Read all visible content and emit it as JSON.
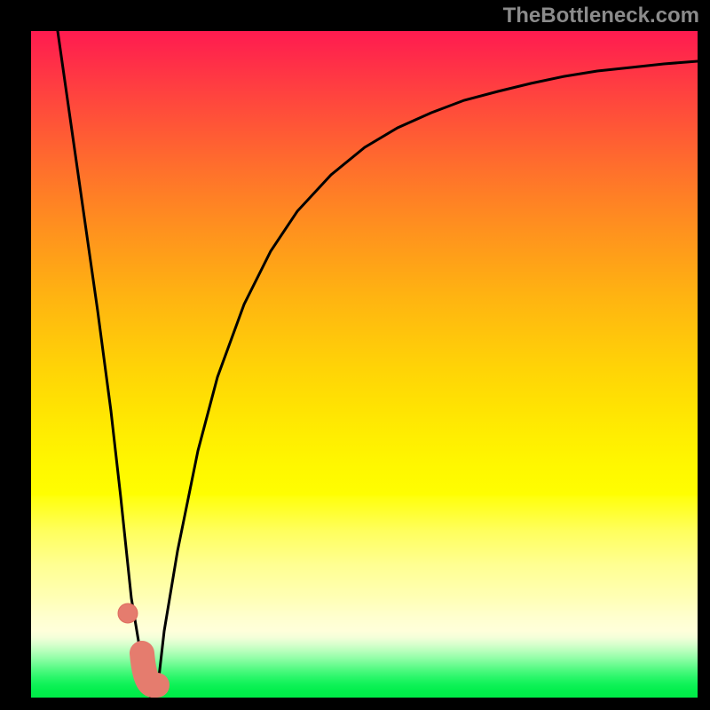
{
  "watermark": "TheBottleneck.com",
  "colors": {
    "page_bg": "#000000",
    "curve_stroke": "#000000",
    "marker_fill": "#e57c6e",
    "marker_stroke": "#de6c5f"
  },
  "chart_data": {
    "type": "line",
    "title": "",
    "xlabel": "",
    "ylabel": "",
    "xlim": [
      0,
      100
    ],
    "ylim": [
      0,
      100
    ],
    "grid": false,
    "series": [
      {
        "name": "bottleneck-curve",
        "x": [
          4,
          6,
          8,
          10,
          12,
          13.5,
          15,
          17,
          18,
          19,
          20,
          22,
          25,
          28,
          32,
          36,
          40,
          45,
          50,
          55,
          60,
          65,
          70,
          75,
          80,
          85,
          90,
          95,
          100
        ],
        "y": [
          100,
          86,
          72,
          58,
          43,
          30,
          15,
          3,
          0,
          2,
          10,
          22,
          37,
          48,
          59,
          67,
          73,
          78.5,
          82.5,
          85.5,
          87.8,
          89.6,
          91,
          92.2,
          93.2,
          94,
          94.6,
          95.1,
          95.5
        ]
      }
    ],
    "markers": [
      {
        "name": "point-a",
        "x": 14.5,
        "y": 13,
        "r": 1.5
      },
      {
        "name": "segment-b",
        "x_start": 16.5,
        "y_start": 7,
        "x_end": 18.5,
        "y_end": 0,
        "width": 3.5
      }
    ],
    "background_gradient": {
      "orientation": "vertical",
      "top_color": "#ff1b50",
      "mid_color": "#ffff01",
      "bottom_color": "#00ea47"
    }
  }
}
